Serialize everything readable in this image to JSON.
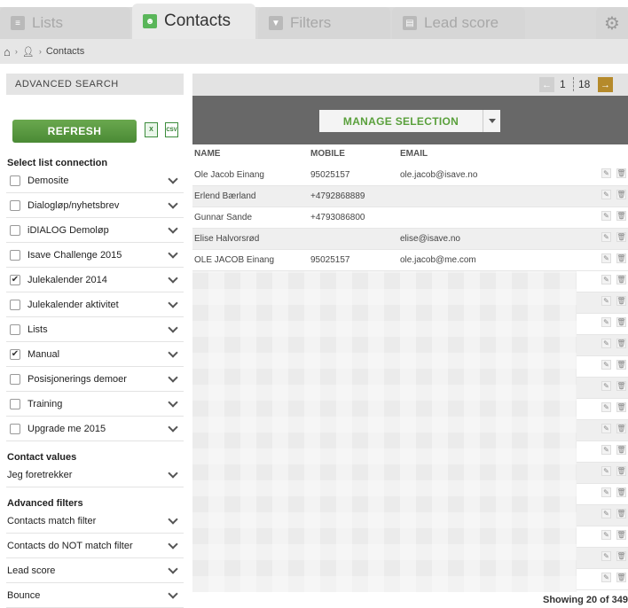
{
  "tabs": [
    {
      "label": "Lists",
      "icon": "list-icon",
      "active": false
    },
    {
      "label": "Contacts",
      "icon": "contacts-icon",
      "active": true
    },
    {
      "label": "Filters",
      "icon": "filter-icon",
      "active": false
    },
    {
      "label": "Lead score",
      "icon": "lead-score-icon",
      "active": false
    }
  ],
  "settings_icon": "gear-icon",
  "breadcrumb": {
    "home_icon": "home-icon",
    "user_icon": "user-icon",
    "current": "Contacts"
  },
  "sidebar": {
    "title": "ADVANCED SEARCH",
    "refresh_label": "REFRESH",
    "xls_label": "X",
    "csv_label": "CSV",
    "list_connection_title": "Select list connection",
    "lists": [
      {
        "label": "Demosite",
        "checked": false
      },
      {
        "label": "Dialogløp/nyhetsbrev",
        "checked": false
      },
      {
        "label": "iDIALOG Demoløp",
        "checked": false
      },
      {
        "label": "Isave Challenge 2015",
        "checked": false
      },
      {
        "label": "Julekalender 2014",
        "checked": true
      },
      {
        "label": "Julekalender aktivitet",
        "checked": false
      },
      {
        "label": "Lists",
        "checked": false
      },
      {
        "label": "Manual",
        "checked": true
      },
      {
        "label": "Posisjonerings demoer",
        "checked": false
      },
      {
        "label": "Training",
        "checked": false
      },
      {
        "label": "Upgrade me 2015",
        "checked": false
      }
    ],
    "contact_values_title": "Contact values",
    "contact_values": [
      {
        "label": "Jeg foretrekker"
      }
    ],
    "advanced_filters_title": "Advanced filters",
    "advanced_filters": [
      {
        "label": "Contacts match filter"
      },
      {
        "label": "Contacts do NOT match filter"
      },
      {
        "label": "Lead score"
      },
      {
        "label": "Bounce"
      }
    ]
  },
  "pager": {
    "current": "1",
    "total": "18"
  },
  "manage_selection_label": "MANAGE SELECTION",
  "table": {
    "columns": [
      "NAME",
      "MOBILE",
      "EMAIL"
    ],
    "rows": [
      {
        "name": "Ole Jacob Einang",
        "mobile": "95025157",
        "email": "ole.jacob@isave.no"
      },
      {
        "name": "Erlend Bærland",
        "mobile": "+4792868889",
        "email": ""
      },
      {
        "name": "Gunnar Sande",
        "mobile": "+4793086800",
        "email": ""
      },
      {
        "name": "Elise Halvorsrød",
        "mobile": "",
        "email": "elise@isave.no"
      },
      {
        "name": "OLE JACOB Einang",
        "mobile": "95025157",
        "email": "ole.jacob@me.com"
      }
    ],
    "row_action_icons": [
      "edit-icon",
      "delete-icon"
    ]
  },
  "footer": {
    "showing": "Showing 20 of 349"
  }
}
